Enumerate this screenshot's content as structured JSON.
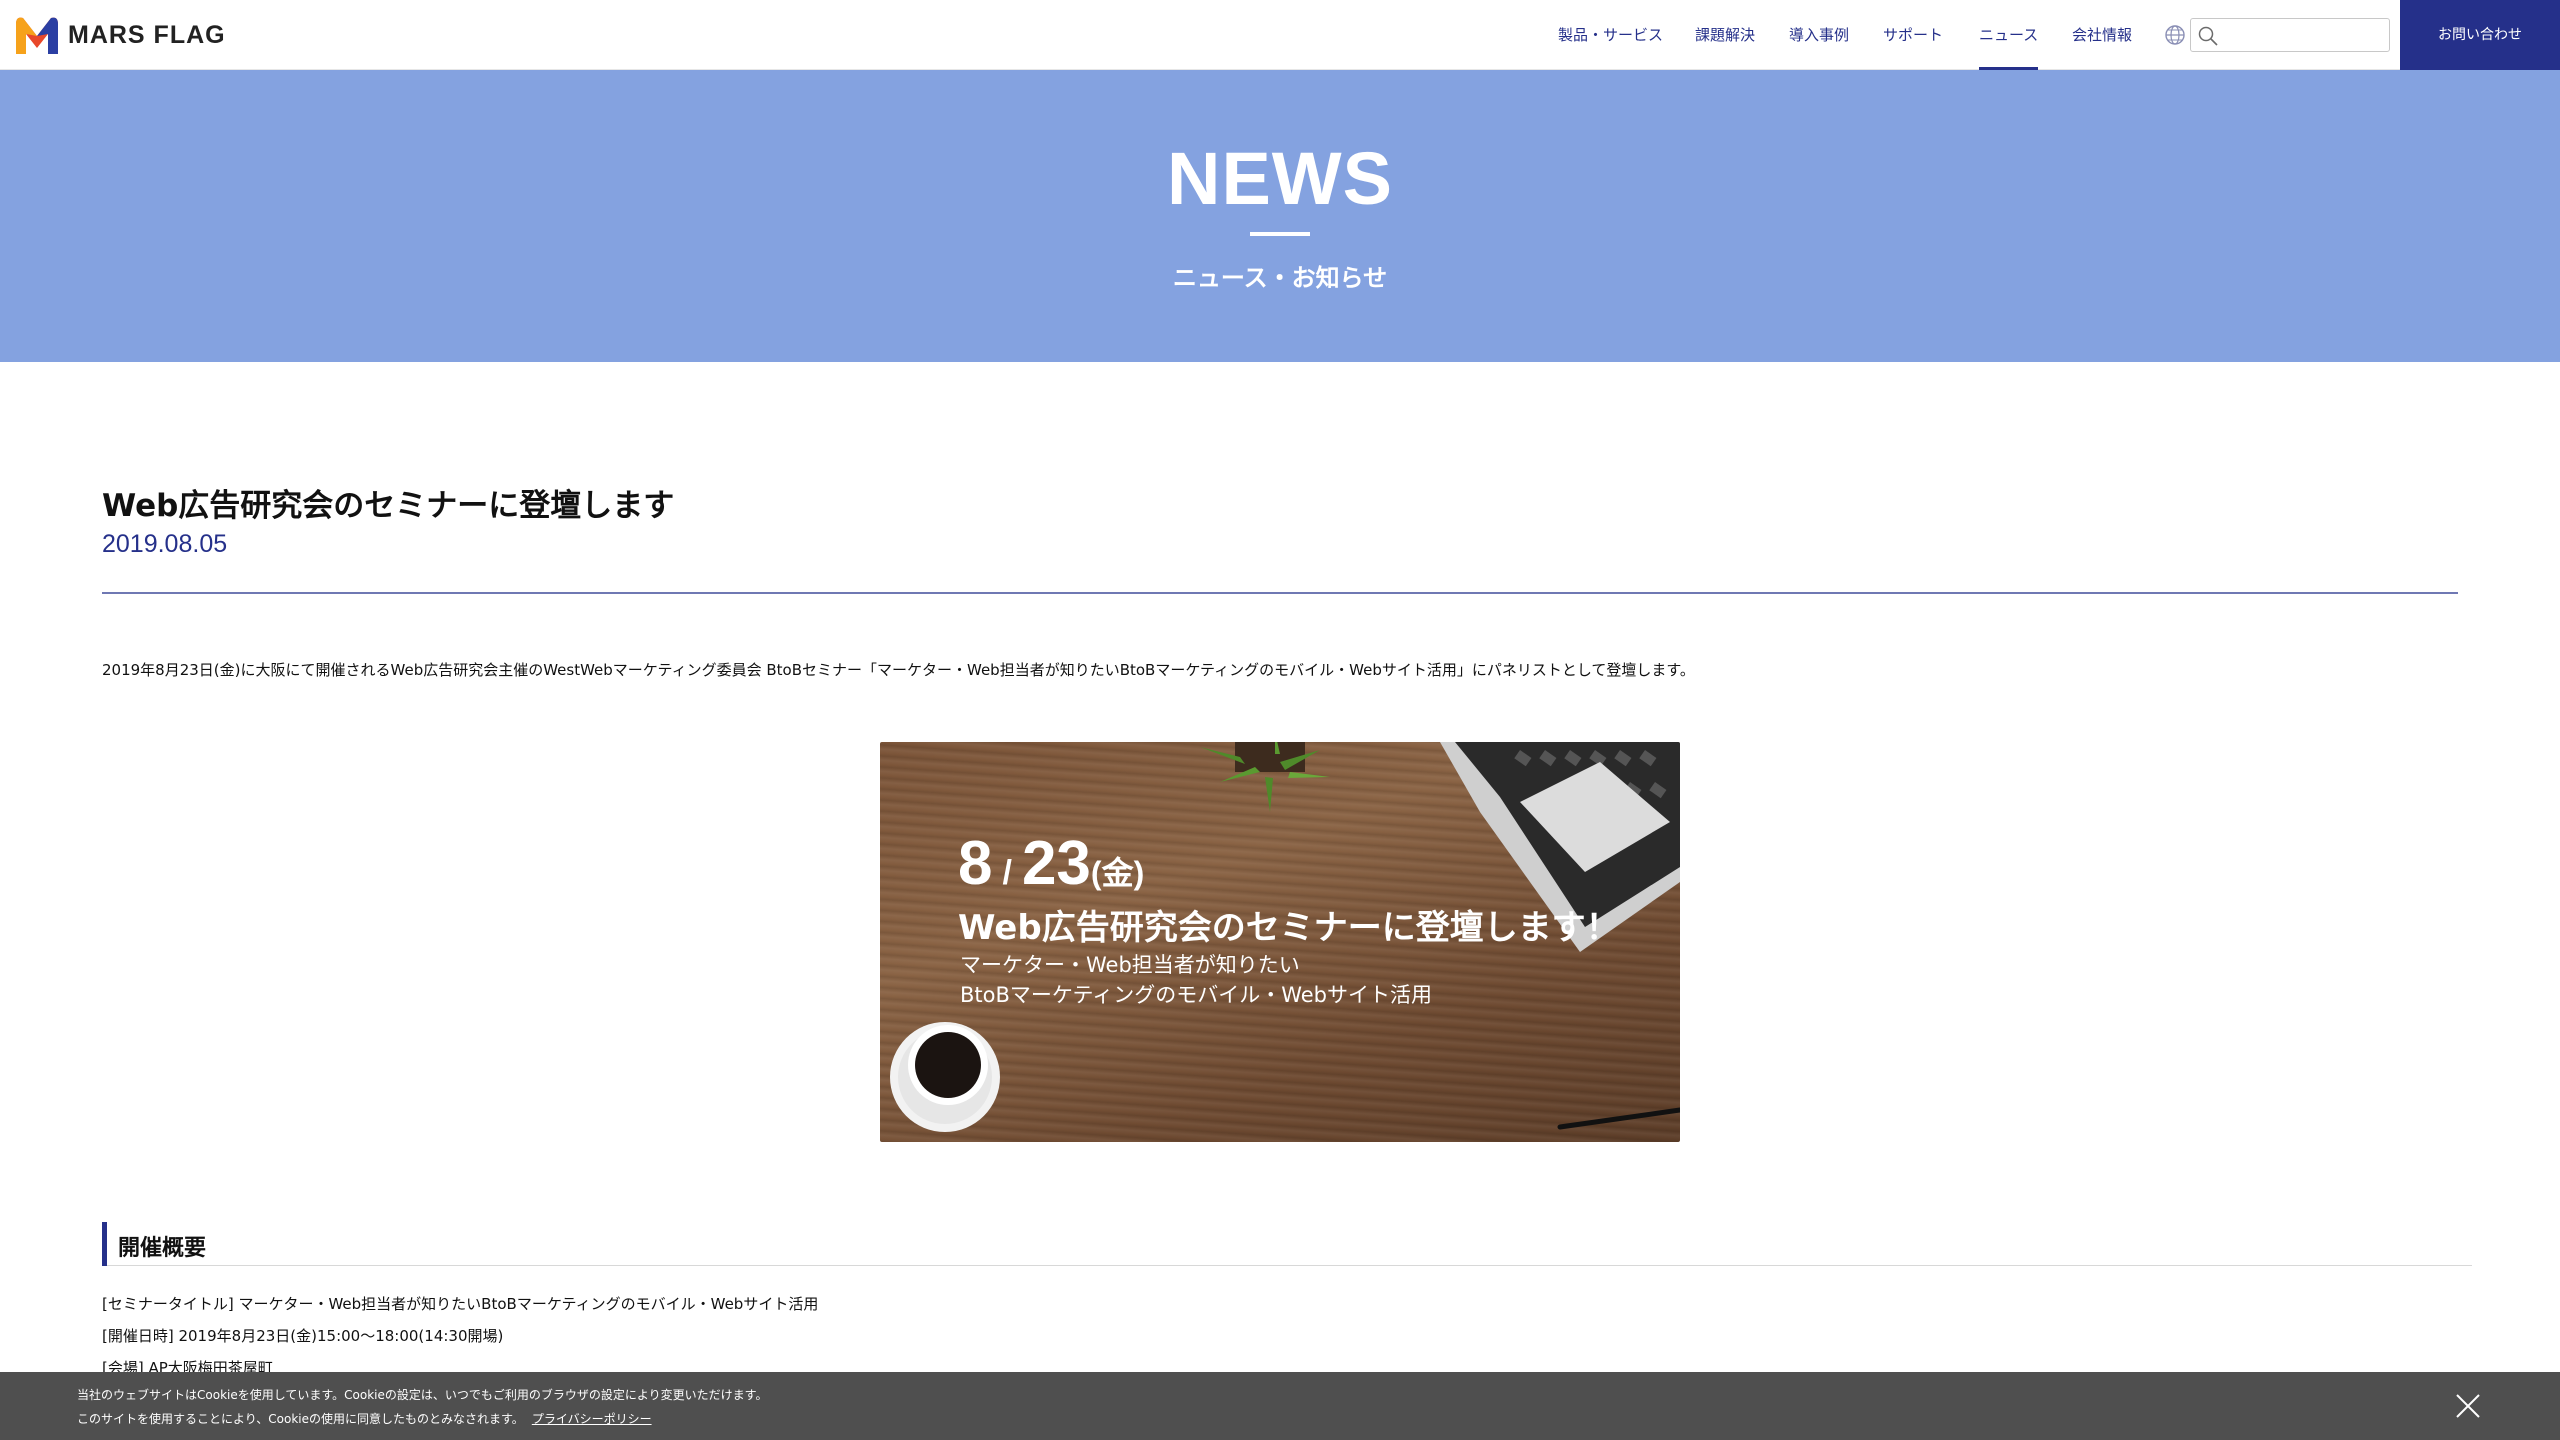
{
  "header": {
    "brand": "MARS FLAG",
    "nav": [
      {
        "label": "製品・サービス"
      },
      {
        "label": "課題解決"
      },
      {
        "label": "導入事例"
      },
      {
        "label": "サポート"
      },
      {
        "label": "ニュース",
        "active": true
      },
      {
        "label": "会社情報"
      }
    ],
    "search_placeholder": "",
    "contact_label": "お問い合わせ"
  },
  "hero": {
    "title": "NEWS",
    "subtitle": "ニュース・お知らせ"
  },
  "article": {
    "title": "Web広告研究会のセミナーに登壇します",
    "date": "2019.08.05",
    "lead": "2019年8月23日(金)に大阪にて開催されるWeb広告研究会主催のWestWebマーケティング委員会 BtoBセミナー「マーケター・Web担当者が知りたいBtoBマーケティングのモバイル・Webサイト活用」にパネリストとして登壇します。",
    "banner": {
      "month": "8",
      "slash": "/",
      "day": "23",
      "dow": "(金)",
      "headline": "Web広告研究会のセミナーに登壇します！",
      "line1": "マーケター・Web担当者が知りたい",
      "line2": "BtoBマーケティングのモバイル・Webサイト活用"
    },
    "section_title": "開催概要",
    "details": [
      "[セミナータイトル] マーケター・Web担当者が知りたいBtoBマーケティングのモバイル・Webサイト活用",
      "[開催日時] 2019年8月23日(金)15:00〜18:00(14:30開場)",
      "[会場] AP大阪梅田茶屋町"
    ]
  },
  "cookie": {
    "line1": "当社のウェブサイトはCookieを使用しています。Cookieの設定は、いつでもご利用のブラウザの設定により変更いただけます。",
    "line2": "このサイトを使用することにより、Cookieの使用に同意したものとみなされます。",
    "link": "プライバシーポリシー"
  },
  "colors": {
    "accent": "#25308a",
    "hero_bg": "#84a2e0",
    "cookie_bg": "#4f4f4f"
  }
}
